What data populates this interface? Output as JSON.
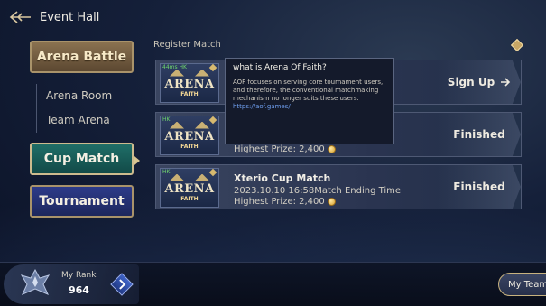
{
  "header": {
    "title": "Event Hall",
    "back_icon": "back-arrow-icon"
  },
  "nav": {
    "arena_battle": "Arena Battle",
    "sub_items": [
      "Arena Room",
      "Team Arena"
    ],
    "cup_match": "Cup Match",
    "tournament": "Tournament"
  },
  "register": {
    "label": "Register Match"
  },
  "matches": [
    {
      "region": "44ms HK",
      "logo_title": "ARENA",
      "logo_sub": "FAITH",
      "status": "Sign Up"
    },
    {
      "region": "HK",
      "logo_title": "ARENA",
      "logo_sub": "FAITH",
      "prize": "Highest Prize: 2,400",
      "status": "Finished"
    },
    {
      "region": "HK",
      "logo_title": "ARENA",
      "logo_sub": "FAITH",
      "title": "Xterio Cup Match",
      "time": "2023.10.10 16:58Match Ending Time",
      "prize": "Highest Prize: 2,400",
      "status": "Finished"
    }
  ],
  "tooltip": {
    "title": "what is Arena Of Faith?",
    "body": "AOF focuses on serving core tournament users, and therefore, the conventional matchmaking mechanism no longer suits these users.",
    "link": "https://aof.games/"
  },
  "rank": {
    "label": "My Rank",
    "value": "964"
  },
  "my_team": "My Team",
  "colors": {
    "accent_gold": "#c8a766",
    "cup_teal": "#1f6e67",
    "tournament_blue": "#2d3b8a",
    "online_green": "#6fd66b"
  }
}
